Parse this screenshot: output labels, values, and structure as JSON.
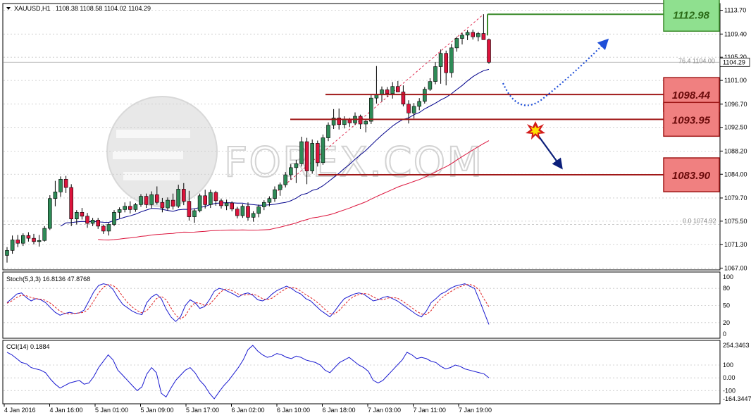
{
  "header": {
    "symbol": "XAUUSD,H1",
    "ohlc": "1108.38 1108.58 1104.02 1104.29"
  },
  "watermark": "FOREX.COM",
  "price_axis": {
    "ticks": [
      "1113.70",
      "1109.40",
      "1105.20",
      "1101.00",
      "1096.70",
      "1092.50",
      "1088.20",
      "1084.00",
      "1079.70",
      "1075.50",
      "1071.30",
      "1067.00"
    ],
    "current": "1104.29"
  },
  "fib": {
    "upper": "76.4  1104.00",
    "lower": "0.0  1074.92"
  },
  "levels": [
    {
      "label": "1112.98",
      "value": 1112.98,
      "style": "green"
    },
    {
      "label": "1098.44",
      "value": 1098.44,
      "style": "red"
    },
    {
      "label": "1093.95",
      "value": 1093.95,
      "style": "red"
    },
    {
      "label": "1083.90",
      "value": 1083.9,
      "style": "red"
    }
  ],
  "stoch": {
    "title": "Stoch(5,3,3) 16.8136 47.8768",
    "ticks": [
      "100",
      "80",
      "50",
      "20",
      "0"
    ]
  },
  "cci": {
    "title": "CCI(14) 0.1884",
    "ticks": [
      "254.3463",
      "100",
      "0.00",
      "-100",
      "-164.3447"
    ]
  },
  "time_axis": [
    "4 Jan 2016",
    "4 Jan 16:00",
    "5 Jan 01:00",
    "5 Jan 09:00",
    "5 Jan 17:00",
    "6 Jan 02:00",
    "6 Jan 10:00",
    "6 Jan 18:00",
    "7 Jan 03:00",
    "7 Jan 11:00",
    "7 Jan 19:00"
  ],
  "colors": {
    "bull": "#2e8b57",
    "bear": "#dc143c",
    "ma_fast": "#00008b",
    "ma_slow": "#dc143c",
    "green_box": "#8fe08f",
    "red_box": "#f08080"
  },
  "chart_data": {
    "type": "candlestick",
    "symbol": "XAUUSD",
    "timeframe": "H1",
    "ohlc": [
      [
        1069.3,
        1070.8,
        1068.0,
        1070.2
      ],
      [
        1070.2,
        1072.9,
        1069.6,
        1072.1
      ],
      [
        1072.1,
        1073.0,
        1070.8,
        1071.5
      ],
      [
        1071.5,
        1073.3,
        1071.0,
        1072.9
      ],
      [
        1072.9,
        1073.5,
        1071.8,
        1072.4
      ],
      [
        1072.4,
        1073.2,
        1071.3,
        1071.8
      ],
      [
        1071.8,
        1073.0,
        1070.9,
        1072.0
      ],
      [
        1072.0,
        1074.6,
        1071.8,
        1074.2
      ],
      [
        1074.2,
        1080.2,
        1073.9,
        1079.6
      ],
      [
        1079.6,
        1082.8,
        1078.2,
        1080.8
      ],
      [
        1080.8,
        1083.6,
        1079.9,
        1083.1
      ],
      [
        1083.1,
        1083.7,
        1080.6,
        1081.6
      ],
      [
        1081.6,
        1082.2,
        1074.6,
        1075.9
      ],
      [
        1075.9,
        1077.5,
        1074.9,
        1077.1
      ],
      [
        1077.1,
        1077.9,
        1075.8,
        1076.4
      ],
      [
        1076.4,
        1077.0,
        1074.3,
        1075.1
      ],
      [
        1075.1,
        1076.1,
        1074.6,
        1075.7
      ],
      [
        1075.7,
        1076.1,
        1074.1,
        1074.6
      ],
      [
        1074.6,
        1074.9,
        1073.2,
        1073.7
      ],
      [
        1073.7,
        1075.2,
        1072.9,
        1074.9
      ],
      [
        1074.9,
        1077.5,
        1074.6,
        1077.1
      ],
      [
        1077.1,
        1078.0,
        1076.0,
        1077.6
      ],
      [
        1077.6,
        1078.9,
        1077.1,
        1078.2
      ],
      [
        1078.2,
        1079.1,
        1076.9,
        1077.6
      ],
      [
        1077.6,
        1078.8,
        1077.2,
        1078.5
      ],
      [
        1078.5,
        1080.4,
        1078.1,
        1080.0
      ],
      [
        1080.0,
        1080.5,
        1077.9,
        1078.5
      ],
      [
        1078.5,
        1080.9,
        1077.8,
        1080.3
      ],
      [
        1080.3,
        1081.8,
        1078.5,
        1078.9
      ],
      [
        1078.9,
        1079.7,
        1077.1,
        1077.9
      ],
      [
        1077.9,
        1079.8,
        1077.4,
        1079.3
      ],
      [
        1079.3,
        1080.5,
        1077.6,
        1078.2
      ],
      [
        1078.2,
        1082.1,
        1077.9,
        1081.3
      ],
      [
        1081.3,
        1082.4,
        1078.4,
        1079.1
      ],
      [
        1079.1,
        1081.0,
        1075.6,
        1076.3
      ],
      [
        1076.3,
        1077.8,
        1075.2,
        1077.4
      ],
      [
        1077.4,
        1080.5,
        1077.1,
        1080.1
      ],
      [
        1080.1,
        1081.2,
        1077.8,
        1078.5
      ],
      [
        1078.5,
        1081.2,
        1077.9,
        1080.7
      ],
      [
        1080.7,
        1081.0,
        1078.3,
        1079.2
      ],
      [
        1079.2,
        1079.6,
        1077.8,
        1078.3
      ],
      [
        1078.3,
        1079.4,
        1077.5,
        1078.8
      ],
      [
        1078.8,
        1079.1,
        1077.3,
        1077.7
      ],
      [
        1077.7,
        1078.1,
        1076.0,
        1076.5
      ],
      [
        1076.5,
        1078.6,
        1076.1,
        1078.2
      ],
      [
        1078.2,
        1078.9,
        1075.6,
        1076.2
      ],
      [
        1076.2,
        1077.3,
        1075.4,
        1076.9
      ],
      [
        1076.9,
        1078.5,
        1076.2,
        1078.1
      ],
      [
        1078.1,
        1079.3,
        1077.5,
        1078.9
      ],
      [
        1078.9,
        1080.0,
        1078.2,
        1079.6
      ],
      [
        1079.6,
        1081.8,
        1079.0,
        1081.2
      ],
      [
        1081.2,
        1082.5,
        1080.1,
        1082.1
      ],
      [
        1082.1,
        1084.4,
        1081.6,
        1083.9
      ],
      [
        1083.9,
        1085.8,
        1083.0,
        1085.2
      ],
      [
        1085.2,
        1086.6,
        1082.4,
        1085.9
      ],
      [
        1085.9,
        1090.8,
        1085.4,
        1089.9
      ],
      [
        1089.9,
        1090.6,
        1082.2,
        1084.6
      ],
      [
        1084.6,
        1090.3,
        1084.1,
        1089.6
      ],
      [
        1089.6,
        1090.1,
        1085.4,
        1086.1
      ],
      [
        1086.1,
        1091.2,
        1085.7,
        1090.6
      ],
      [
        1090.6,
        1093.4,
        1090.0,
        1092.9
      ],
      [
        1092.9,
        1095.8,
        1092.2,
        1094.2
      ],
      [
        1094.2,
        1095.9,
        1092.1,
        1093.0
      ],
      [
        1093.0,
        1094.5,
        1092.3,
        1093.9
      ],
      [
        1093.9,
        1094.2,
        1092.6,
        1093.3
      ],
      [
        1093.3,
        1095.2,
        1092.9,
        1094.5
      ],
      [
        1094.5,
        1094.8,
        1092.2,
        1093.1
      ],
      [
        1093.1,
        1094.0,
        1091.6,
        1093.6
      ],
      [
        1093.6,
        1098.5,
        1093.1,
        1097.8
      ],
      [
        1097.8,
        1103.6,
        1096.8,
        1098.5
      ],
      [
        1098.5,
        1099.9,
        1097.2,
        1099.3
      ],
      [
        1099.3,
        1099.8,
        1098.0,
        1098.6
      ],
      [
        1098.6,
        1100.7,
        1097.7,
        1099.9
      ],
      [
        1099.9,
        1100.9,
        1098.9,
        1098.9
      ],
      [
        1098.9,
        1100.1,
        1096.3,
        1096.7
      ],
      [
        1096.7,
        1097.4,
        1093.2,
        1095.1
      ],
      [
        1095.1,
        1096.9,
        1094.1,
        1096.3
      ],
      [
        1096.3,
        1097.8,
        1095.6,
        1097.2
      ],
      [
        1097.2,
        1099.8,
        1096.8,
        1099.4
      ],
      [
        1099.4,
        1101.4,
        1099.1,
        1100.8
      ],
      [
        1100.8,
        1104.3,
        1100.3,
        1103.5
      ],
      [
        1103.5,
        1106.6,
        1100.4,
        1105.9
      ],
      [
        1105.9,
        1106.4,
        1100.1,
        1102.4
      ],
      [
        1102.4,
        1107.6,
        1101.5,
        1106.9
      ],
      [
        1106.9,
        1108.9,
        1106.2,
        1108.6
      ],
      [
        1108.6,
        1109.6,
        1107.5,
        1109.2
      ],
      [
        1109.2,
        1110.1,
        1108.3,
        1109.7
      ],
      [
        1109.7,
        1110.2,
        1108.4,
        1108.9
      ],
      [
        1108.9,
        1109.8,
        1108.1,
        1109.5
      ],
      [
        1109.5,
        1112.98,
        1108.6,
        1108.38
      ],
      [
        1108.38,
        1108.58,
        1104.02,
        1104.29
      ]
    ],
    "ma_fast_period": 20,
    "ma_slow_period": 50,
    "levels": [
      1112.98,
      1098.44,
      1093.95,
      1083.9
    ],
    "fibonacci": {
      "high": 1104.0,
      "low": 1074.92
    },
    "ylim": [
      1066.8,
      1114.8
    ],
    "stochastic": {
      "params": "5,3,3",
      "k": [
        55,
        62,
        70,
        72,
        64,
        58,
        62,
        60,
        55,
        46,
        38,
        33,
        36,
        38,
        36,
        37,
        42,
        58,
        74,
        85,
        88,
        86,
        78,
        64,
        52,
        46,
        40,
        36,
        34,
        55,
        65,
        70,
        62,
        44,
        30,
        22,
        30,
        50,
        60,
        55,
        45,
        48,
        60,
        75,
        80,
        78,
        74,
        70,
        65,
        70,
        72,
        68,
        60,
        58,
        62,
        70,
        76,
        80,
        84,
        80,
        74,
        70,
        62,
        58,
        50,
        42,
        36,
        30,
        40,
        52,
        62,
        66,
        70,
        72,
        70,
        64,
        58,
        60,
        64,
        66,
        62,
        58,
        52,
        46,
        40,
        34,
        30,
        40,
        55,
        62,
        70,
        74,
        80,
        84,
        86,
        88,
        84,
        80,
        60,
        38,
        16.8
      ],
      "d": [
        54,
        58,
        64,
        68,
        67,
        64,
        62,
        61,
        59,
        54,
        47,
        40,
        36,
        35,
        36,
        37,
        38,
        45,
        58,
        72,
        82,
        87,
        85,
        78,
        66,
        55,
        47,
        41,
        37,
        41,
        51,
        62,
        66,
        60,
        46,
        33,
        26,
        32,
        46,
        55,
        54,
        50,
        52,
        61,
        71,
        78,
        78,
        75,
        70,
        68,
        69,
        70,
        67,
        62,
        60,
        63,
        69,
        75,
        80,
        82,
        80,
        75,
        69,
        64,
        58,
        51,
        43,
        36,
        35,
        42,
        51,
        60,
        66,
        69,
        71,
        70,
        65,
        61,
        60,
        63,
        64,
        63,
        58,
        52,
        46,
        40,
        35,
        34,
        41,
        52,
        62,
        68,
        74,
        79,
        83,
        86,
        87,
        84,
        77,
        61,
        47.9
      ]
    },
    "cci": {
      "period": 14,
      "values": [
        200,
        180,
        150,
        120,
        110,
        80,
        70,
        60,
        40,
        -10,
        -50,
        -80,
        -60,
        -40,
        -30,
        -20,
        -50,
        -40,
        10,
        80,
        130,
        180,
        140,
        60,
        20,
        -20,
        -60,
        -100,
        -70,
        30,
        80,
        40,
        -120,
        -150,
        -80,
        -20,
        20,
        60,
        80,
        40,
        -20,
        -60,
        -120,
        -164,
        -110,
        -60,
        -20,
        30,
        80,
        140,
        220,
        254,
        210,
        180,
        160,
        170,
        190,
        180,
        160,
        150,
        170,
        160,
        140,
        130,
        120,
        100,
        60,
        40,
        80,
        120,
        140,
        160,
        130,
        100,
        80,
        50,
        -20,
        -40,
        -20,
        20,
        60,
        100,
        140,
        200,
        180,
        150,
        160,
        150,
        130,
        120,
        90,
        70,
        80,
        100,
        90,
        70,
        60,
        50,
        40,
        30,
        0.2
      ]
    },
    "x_ticks": [
      "4 Jan 2016",
      "4 Jan 16:00",
      "5 Jan 01:00",
      "5 Jan 09:00",
      "5 Jan 17:00",
      "6 Jan 02:00",
      "6 Jan 10:00",
      "6 Jan 18:00",
      "7 Jan 03:00",
      "7 Jan 11:00",
      "7 Jan 19:00"
    ]
  }
}
